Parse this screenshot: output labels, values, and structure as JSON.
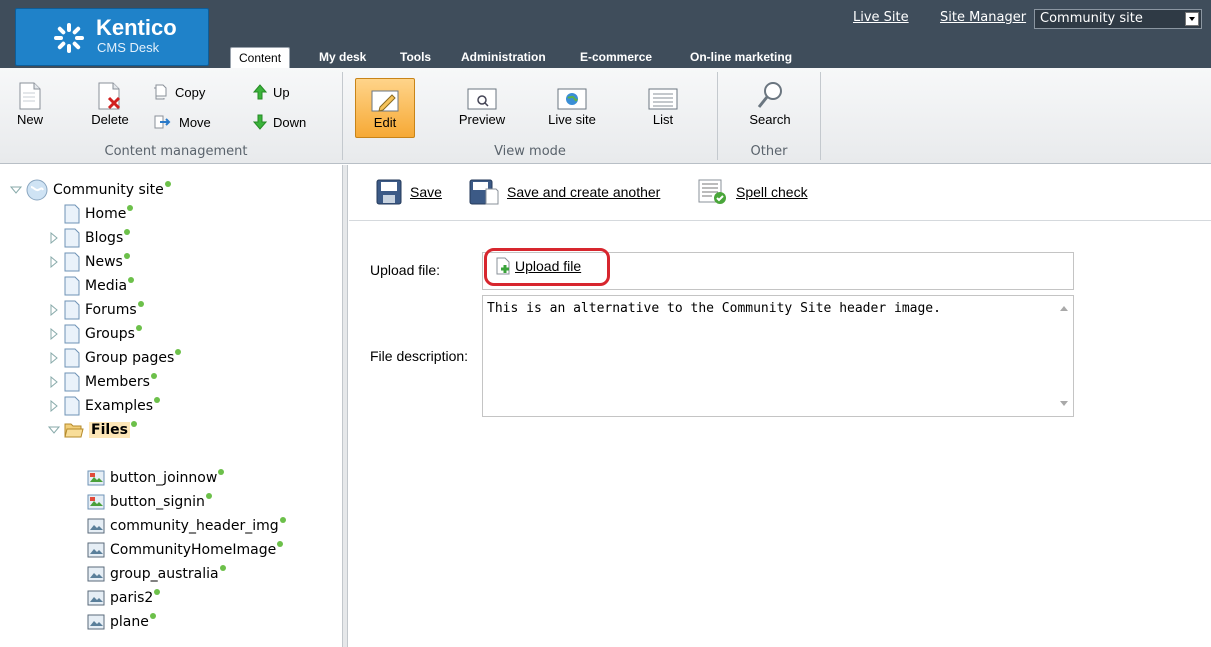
{
  "header": {
    "logo_name": "Kentico",
    "logo_sub": "CMS Desk",
    "tabs": [
      "Content",
      "My desk",
      "Tools",
      "Administration",
      "E-commerce",
      "On-line marketing"
    ],
    "links": {
      "live_site": "Live Site",
      "site_manager": "Site Manager"
    },
    "site_selector": "Community site"
  },
  "toolbar": {
    "content_management": {
      "label": "Content management",
      "new": "New",
      "delete": "Delete",
      "copy": "Copy",
      "move": "Move",
      "up": "Up",
      "down": "Down"
    },
    "view_mode": {
      "label": "View mode",
      "edit": "Edit",
      "preview": "Preview",
      "live_site": "Live site",
      "list": "List"
    },
    "other": {
      "label": "Other",
      "search": "Search"
    }
  },
  "tree": {
    "root": "Community site",
    "items": [
      "Home",
      "Blogs",
      "News",
      "Media",
      "Forums",
      "Groups",
      "Group pages",
      "Members",
      "Examples"
    ],
    "selected": "Files",
    "children": [
      "button_joinnow",
      "button_signin",
      "community_header_img",
      "CommunityHomeImage",
      "group_australia",
      "paris2",
      "plane"
    ]
  },
  "actions": {
    "save": "Save",
    "save_create": "Save and create another",
    "spell_check": "Spell check"
  },
  "form": {
    "upload_label": "Upload file:",
    "upload_button": "Upload file",
    "desc_label": "File description:",
    "desc_value": "This is an alternative to the Community Site header image."
  },
  "colors": {
    "header_bg": "#3f4d5b",
    "logo_bg": "#1f82c9",
    "highlight": "#d7262e",
    "status_dot": "#6cc04a",
    "edit_active": "#f6a935"
  }
}
